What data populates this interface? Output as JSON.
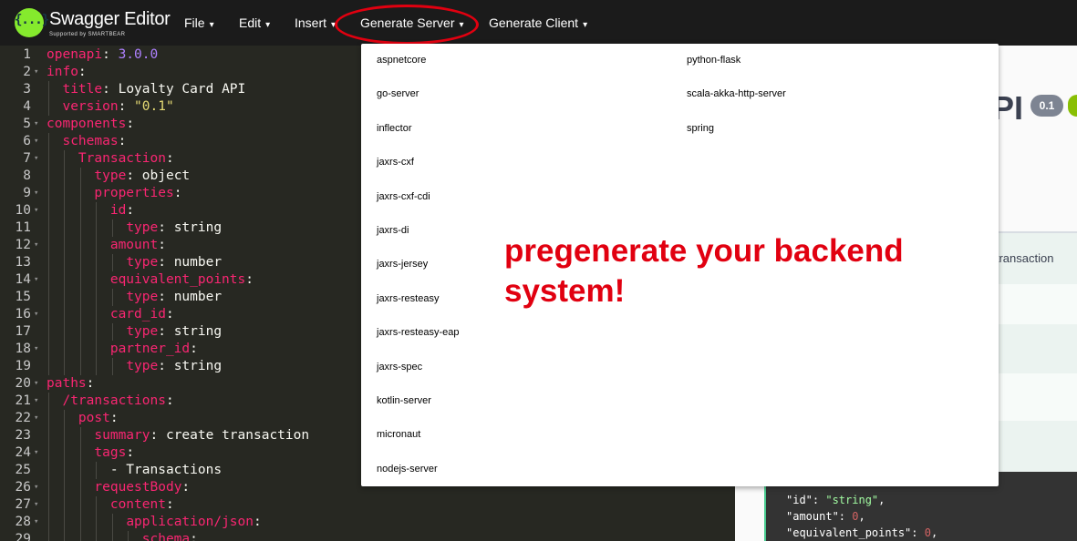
{
  "header": {
    "logo_glyph": "{...}",
    "title": "Swagger Editor",
    "subtitle": "Supported by SMARTBEAR",
    "menus": [
      {
        "label": "File",
        "caret": "▾"
      },
      {
        "label": "Edit",
        "caret": "▾"
      },
      {
        "label": "Insert",
        "caret": "▾"
      },
      {
        "label": "Generate Server",
        "caret": "▾"
      },
      {
        "label": "Generate Client",
        "caret": "▾"
      }
    ]
  },
  "editor": {
    "lines": [
      {
        "n": "1",
        "fold": "",
        "indent": "",
        "key": "openapi",
        "value": "3.0.0",
        "vtype": "num"
      },
      {
        "n": "2",
        "fold": "▾",
        "indent": "",
        "key": "info",
        "value": "",
        "vtype": ""
      },
      {
        "n": "3",
        "fold": "",
        "indent": "  ",
        "key": "title",
        "value": "Loyalty Card API",
        "vtype": "plain"
      },
      {
        "n": "4",
        "fold": "",
        "indent": "  ",
        "key": "version",
        "value": "\"0.1\"",
        "vtype": "str"
      },
      {
        "n": "5",
        "fold": "▾",
        "indent": "",
        "key": "components",
        "value": "",
        "vtype": ""
      },
      {
        "n": "6",
        "fold": "▾",
        "indent": "  ",
        "key": "schemas",
        "value": "",
        "vtype": ""
      },
      {
        "n": "7",
        "fold": "▾",
        "indent": "    ",
        "key": "Transaction",
        "value": "",
        "vtype": ""
      },
      {
        "n": "8",
        "fold": "",
        "indent": "      ",
        "key": "type",
        "value": "object",
        "vtype": "plain"
      },
      {
        "n": "9",
        "fold": "▾",
        "indent": "      ",
        "key": "properties",
        "value": "",
        "vtype": ""
      },
      {
        "n": "10",
        "fold": "▾",
        "indent": "        ",
        "key": "id",
        "value": "",
        "vtype": ""
      },
      {
        "n": "11",
        "fold": "",
        "indent": "          ",
        "key": "type",
        "value": "string",
        "vtype": "plain"
      },
      {
        "n": "12",
        "fold": "▾",
        "indent": "        ",
        "key": "amount",
        "value": "",
        "vtype": ""
      },
      {
        "n": "13",
        "fold": "",
        "indent": "          ",
        "key": "type",
        "value": "number",
        "vtype": "plain"
      },
      {
        "n": "14",
        "fold": "▾",
        "indent": "        ",
        "key": "equivalent_points",
        "value": "",
        "vtype": ""
      },
      {
        "n": "15",
        "fold": "",
        "indent": "          ",
        "key": "type",
        "value": "number",
        "vtype": "plain"
      },
      {
        "n": "16",
        "fold": "▾",
        "indent": "        ",
        "key": "card_id",
        "value": "",
        "vtype": ""
      },
      {
        "n": "17",
        "fold": "",
        "indent": "          ",
        "key": "type",
        "value": "string",
        "vtype": "plain"
      },
      {
        "n": "18",
        "fold": "▾",
        "indent": "        ",
        "key": "partner_id",
        "value": "",
        "vtype": ""
      },
      {
        "n": "19",
        "fold": "",
        "indent": "          ",
        "key": "type",
        "value": "string",
        "vtype": "plain"
      },
      {
        "n": "20",
        "fold": "▾",
        "indent": "",
        "key": "paths",
        "value": "",
        "vtype": ""
      },
      {
        "n": "21",
        "fold": "▾",
        "indent": "  ",
        "key": "/transactions",
        "value": "",
        "vtype": ""
      },
      {
        "n": "22",
        "fold": "▾",
        "indent": "    ",
        "key": "post",
        "value": "",
        "vtype": ""
      },
      {
        "n": "23",
        "fold": "",
        "indent": "      ",
        "key": "summary",
        "value": "create transaction",
        "vtype": "plain"
      },
      {
        "n": "24",
        "fold": "▾",
        "indent": "      ",
        "key": "tags",
        "value": "",
        "vtype": ""
      },
      {
        "n": "25",
        "fold": "",
        "indent": "        ",
        "key": "",
        "value": "- Transactions",
        "vtype": "plain"
      },
      {
        "n": "26",
        "fold": "▾",
        "indent": "      ",
        "key": "requestBody",
        "value": "",
        "vtype": ""
      },
      {
        "n": "27",
        "fold": "▾",
        "indent": "        ",
        "key": "content",
        "value": "",
        "vtype": ""
      },
      {
        "n": "28",
        "fold": "▾",
        "indent": "          ",
        "key": "application/json",
        "value": "",
        "vtype": ""
      },
      {
        "n": "29",
        "fold": "",
        "indent": "            ",
        "key": "schema",
        "value": "",
        "vtype": ""
      }
    ]
  },
  "preview": {
    "api_title_fragment": "PI",
    "version_badge": "0.1",
    "op_summary_fragment": "e transaction",
    "example_lines": [
      {
        "key": "\"id\"",
        "value": "\"string\"",
        "vtype": "str"
      },
      {
        "key": "\"amount\"",
        "value": "0",
        "vtype": "num"
      },
      {
        "key": "\"equivalent_points\"",
        "value": "0",
        "vtype": "num"
      }
    ]
  },
  "dropdown": {
    "left_column": [
      "aspnetcore",
      "go-server",
      "inflector",
      "jaxrs-cxf",
      "jaxrs-cxf-cdi",
      "jaxrs-di",
      "jaxrs-jersey",
      "jaxrs-resteasy",
      "jaxrs-resteasy-eap",
      "jaxrs-spec",
      "kotlin-server",
      "micronaut",
      "nodejs-server"
    ],
    "right_column": [
      "python-flask",
      "scala-akka-http-server",
      "spring"
    ]
  },
  "annotation": {
    "text": "pregenerate your backend system!",
    "color": "#e10010"
  }
}
